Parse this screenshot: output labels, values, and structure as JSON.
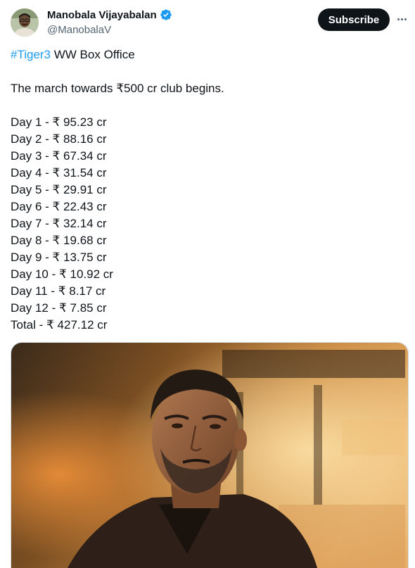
{
  "author": {
    "name": "Manobala Vijayabalan",
    "handle": "@ManobalaV",
    "verified": true
  },
  "actions": {
    "subscribe_label": "Subscribe",
    "more_icon": "more-icon"
  },
  "post": {
    "hashtag": "#Tiger3",
    "headline_rest": " WW Box Office",
    "tagline": "The march towards ₹500 cr club begins.",
    "days": [
      "Day 1 - ₹ 95.23 cr",
      "Day 2 - ₹ 88.16 cr",
      "Day 3 - ₹ 67.34 cr",
      "Day 4 - ₹ 31.54 cr",
      "Day 5 - ₹ 29.91 cr",
      "Day 6 - ₹ 22.43 cr",
      "Day 7 - ₹ 32.14 cr",
      "Day 8 - ₹ 19.68 cr",
      "Day 9 - ₹ 13.75 cr",
      "Day 10 - ₹ 10.92 cr",
      "Day 11 - ₹ 8.17 cr",
      "Day 12 - ₹ 7.85 cr"
    ],
    "total": "Total - ₹ 427.12 cr"
  },
  "colors": {
    "hashtag": "#1d9bf0",
    "text": "#0f1419",
    "secondary": "#536471",
    "verified": "#1d9bf0",
    "button_bg": "#0f1419"
  }
}
